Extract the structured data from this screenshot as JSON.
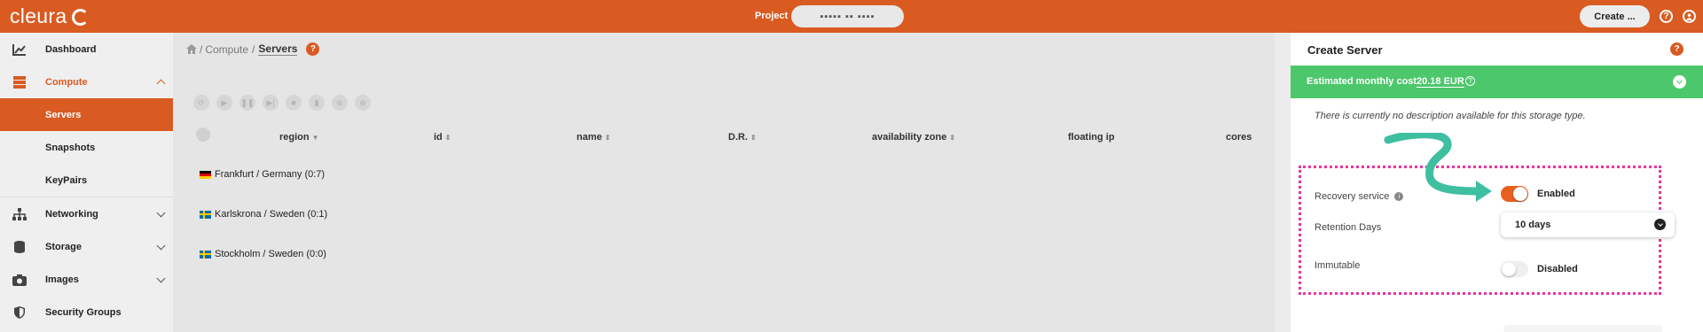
{
  "topbar": {
    "brand": "cleura",
    "project_label": "Project",
    "project_value": "▪▪▪▪▪ ▪▪ ▪▪▪▪",
    "create_label": "Create ...",
    "colors": {
      "brand": "#d95b22"
    }
  },
  "sidebar": {
    "items": [
      {
        "label": "Dashboard",
        "icon": "chart-icon"
      },
      {
        "label": "Compute",
        "icon": "server-icon"
      },
      {
        "label": "Servers"
      },
      {
        "label": "Snapshots"
      },
      {
        "label": "KeyPairs"
      },
      {
        "label": "Networking",
        "icon": "network-icon"
      },
      {
        "label": "Storage",
        "icon": "database-icon"
      },
      {
        "label": "Images",
        "icon": "camera-icon"
      },
      {
        "label": "Security Groups",
        "icon": "shield-icon"
      }
    ]
  },
  "main": {
    "breadcrumb": {
      "part1": "Compute",
      "current": "Servers",
      "sep": "/"
    },
    "columns": [
      "region",
      "id",
      "name",
      "D.R.",
      "availability zone",
      "floating ip",
      "cores"
    ],
    "rows": [
      "Frankfurt / Germany  (0:7)",
      "Karlskrona / Sweden  (0:1)",
      "Stockholm / Sweden  (0:0)"
    ]
  },
  "panel": {
    "title": "Create Server",
    "cost_label": "Estimated monthly cost",
    "cost_value": "20.18 EUR",
    "description": "There is currently no description available for this storage type.",
    "recovery": {
      "label": "Recovery service",
      "state": "Enabled",
      "on": true
    },
    "retention": {
      "label": "Retention Days",
      "value": "10 days"
    },
    "immutable": {
      "label": "Immutable",
      "state": "Disabled",
      "on": false
    },
    "colors": {
      "cost_bar": "#4cc76b",
      "highlight": "#e8359e",
      "arrow": "#3dbfa0"
    }
  }
}
